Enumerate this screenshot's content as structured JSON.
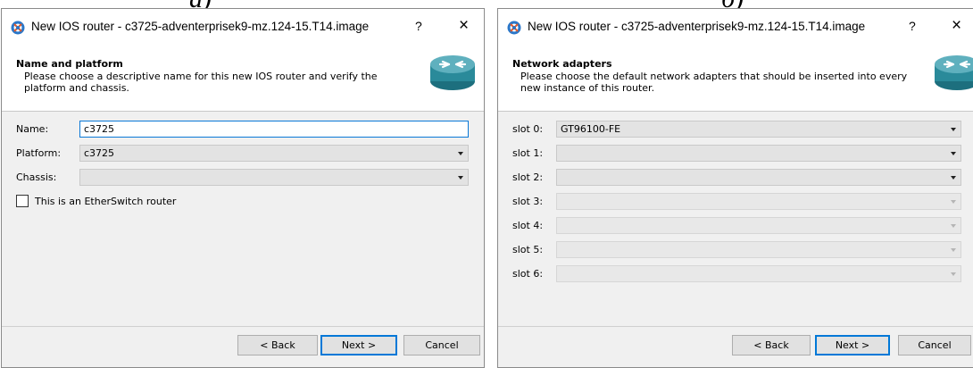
{
  "figure_labels": [
    "a)",
    "б)"
  ],
  "dialog_a": {
    "title": "New IOS router - c3725-adventerprisek9-mz.124-15.T14.image",
    "help": "?",
    "close": "×",
    "header_title": "Name and platform",
    "header_desc_1": "Please choose a descriptive name for this new IOS router and verify the",
    "header_desc_2": "platform and chassis.",
    "name_label": "Name:",
    "name_value": "c3725",
    "platform_label": "Platform:",
    "platform_value": "c3725",
    "chassis_label": "Chassis:",
    "chassis_value": "",
    "etherswitch_label": "This is an EtherSwitch router",
    "back": "< Back",
    "next": "Next >",
    "cancel": "Cancel"
  },
  "dialog_b": {
    "title": "New IOS router - c3725-adventerprisek9-mz.124-15.T14.image",
    "help": "?",
    "close": "×",
    "header_title": "Network adapters",
    "header_desc_1": "Please choose the default network adapters that should be inserted into every",
    "header_desc_2": "new instance of this router.",
    "slots": [
      {
        "label": "slot 0:",
        "value": "GT96100-FE",
        "enabled": true
      },
      {
        "label": "slot 1:",
        "value": "",
        "enabled": true
      },
      {
        "label": "slot 2:",
        "value": "",
        "enabled": true
      },
      {
        "label": "slot 3:",
        "value": "",
        "enabled": false
      },
      {
        "label": "slot 4:",
        "value": "",
        "enabled": false
      },
      {
        "label": "slot 5:",
        "value": "",
        "enabled": false
      },
      {
        "label": "slot 6:",
        "value": "",
        "enabled": false
      }
    ],
    "back": "< Back",
    "next": "Next >",
    "cancel": "Cancel"
  },
  "colors": {
    "accent": "#0078d7",
    "dialog_bg": "#f0f0f0"
  }
}
